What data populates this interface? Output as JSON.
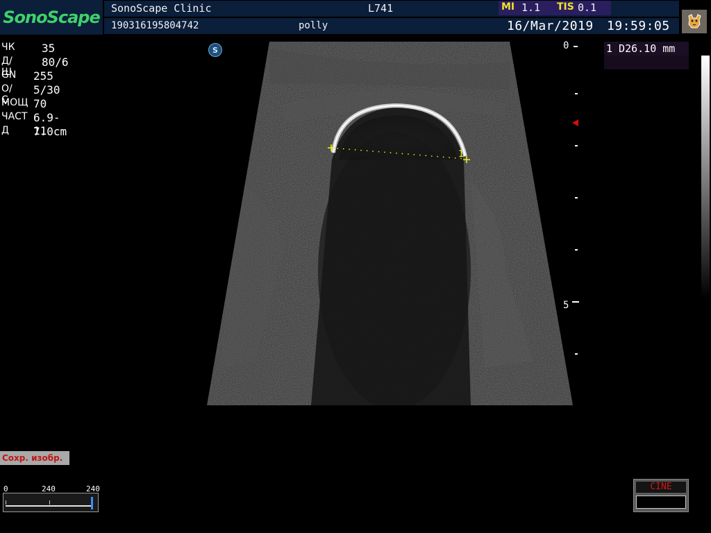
{
  "header": {
    "logo": "SonoScape",
    "clinic": "SonoScape Clinic",
    "probe": "L741",
    "patient_id": "190316195804742",
    "patient_name": "polly",
    "date": "16/Mar/2019",
    "time": "19:59:05",
    "mi_label": "MI",
    "mi_value": "1.1",
    "tis_label": "TIS",
    "tis_value": "0.1"
  },
  "params": [
    {
      "label": "ЧК",
      "value": "35"
    },
    {
      "label": "Д/Ш",
      "value": "80/6"
    },
    {
      "label": "GN",
      "value": "255"
    },
    {
      "label": "О/С",
      "value": "5/30"
    },
    {
      "label": "МОЩ",
      "value": "70"
    },
    {
      "label": "ЧАСТ",
      "value": "6.9-11"
    },
    {
      "label": "Д",
      "value": "7.0cm"
    }
  ],
  "depth_scale": {
    "top_label": "0",
    "mid_label": "5"
  },
  "measurement": {
    "text": "1 D26.10 mm",
    "marker_label": "1"
  },
  "save_button": {
    "label": "Сохр. изобр."
  },
  "gain_slider": {
    "min_label": "0",
    "mid_label": "240",
    "max_label": "240",
    "value_fraction": 1.0
  },
  "cine": {
    "label": "CINE"
  },
  "icons": {
    "corner": "dog-icon",
    "probe_marker": "sonoscape-s-icon",
    "focus": "focus-triangle-icon"
  },
  "colors": {
    "header_bg": "#0b1e3a",
    "logo_green": "#3fd16a",
    "caliper_yellow": "#f2f21a",
    "focus_red": "#d01010",
    "save_text_red": "#c31515"
  }
}
